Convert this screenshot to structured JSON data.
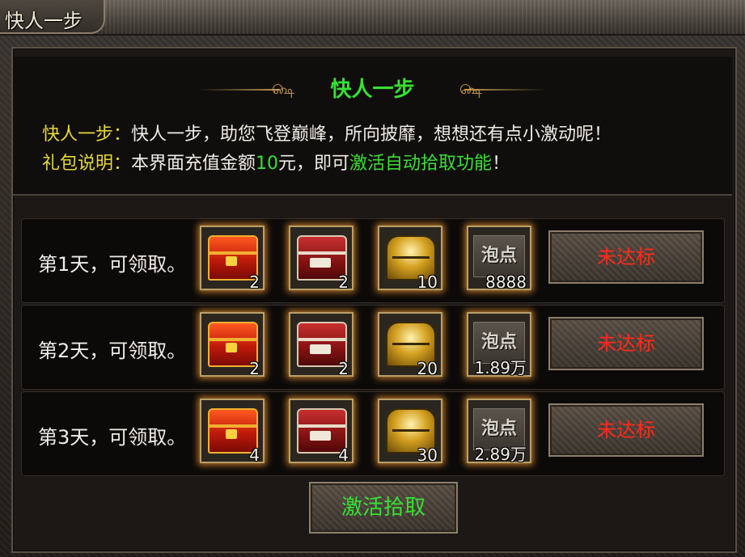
{
  "window": {
    "title": "快人一步"
  },
  "info": {
    "heading": "快人一步",
    "line1_label": "快人一步：",
    "line1_text": "快人一步，助您飞登巅峰，所向披靡，想想还有点小激动呢！",
    "line2_label": "礼包说明：",
    "line2_pre": "本界面充值金额",
    "line2_amount": "10",
    "line2_mid": "元，即可",
    "line2_highlight": "激活自动拾取功能",
    "line2_end": "！"
  },
  "days": [
    {
      "label": "第1天，可领取。",
      "items": [
        "2",
        "2",
        "10"
      ],
      "points_icon": "泡点",
      "points": "8888",
      "status": "未达标"
    },
    {
      "label": "第2天，可领取。",
      "items": [
        "2",
        "2",
        "20"
      ],
      "points_icon": "泡点",
      "points": "1.89万",
      "status": "未达标"
    },
    {
      "label": "第3天，可领取。",
      "items": [
        "4",
        "4",
        "30"
      ],
      "points_icon": "泡点",
      "points": "2.89万",
      "status": "未达标"
    }
  ],
  "item_icons": [
    "red-gold-chest-icon",
    "crimson-chest-icon",
    "gold-treasure-chest-icon"
  ],
  "activate_button": "激活拾取",
  "colors": {
    "highlight_green": "#37e034",
    "label_yellow": "#e6d83a",
    "status_red": "#ff2a1a"
  }
}
